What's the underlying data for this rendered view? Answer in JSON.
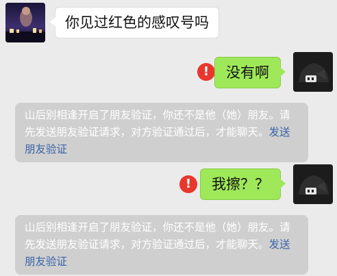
{
  "messages": {
    "incoming": {
      "text": "你见过红色的感叹号吗"
    },
    "outgoing1": {
      "text": "没有啊",
      "status_icon_text": "!"
    },
    "outgoing2": {
      "text": "我擦？？",
      "status_icon_text": "!"
    }
  },
  "system_notice": {
    "text": "山后别相逢开启了朋友验证，你还不是他（她）朋友。请先发送朋友验证请求，对方验证通过后，才能聊天。",
    "link": "发送朋友验证"
  },
  "colors": {
    "background": "#ebebeb",
    "outgoing_bubble": "#9fe85a",
    "incoming_bubble": "#ffffff",
    "error": "#e8372c",
    "notice_bg": "#cfcfcf",
    "link": "#3a63a8"
  }
}
